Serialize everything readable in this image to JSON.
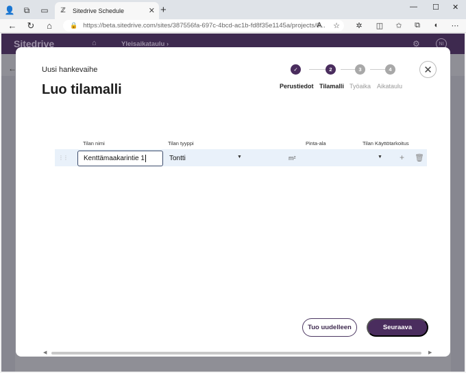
{
  "browser": {
    "tab_title": "Sitedrive Schedule",
    "url": "https://beta.sitedrive.com/sites/387556fa-697c-4bcd-ac1b-fd8f35e1145a/projects/0..."
  },
  "app": {
    "brand": "Sitedrive",
    "breadcrumb": "Yleisaikataulu",
    "user_initials": "NI"
  },
  "modal": {
    "subtitle": "Uusi hankevaihe",
    "title": "Luo tilamalli",
    "steps": [
      {
        "number": "",
        "label": "Perustiedot",
        "state": "done"
      },
      {
        "number": "2",
        "label": "Tilamalli",
        "state": "active"
      },
      {
        "number": "3",
        "label": "Työaika",
        "state": "pending"
      },
      {
        "number": "4",
        "label": "Aikataulu",
        "state": "pending"
      }
    ],
    "columns": {
      "name": "Tilan nimi",
      "type": "Tilan tyyppi",
      "area": "Pinta-ala",
      "usage": "Tilan Käyttötarkoitus"
    },
    "row": {
      "name_value": "Kenttämaakarintie 1",
      "type_value": "Tontti",
      "area_unit": "m²"
    },
    "buttons": {
      "secondary": "Tuo uudelleen",
      "primary": "Seuraava"
    }
  },
  "colors": {
    "primary": "#4a2d5e",
    "step_done": "#4a2d5e",
    "step_pending": "#a8a8a8",
    "nav_bg": "#3e2a4f"
  }
}
